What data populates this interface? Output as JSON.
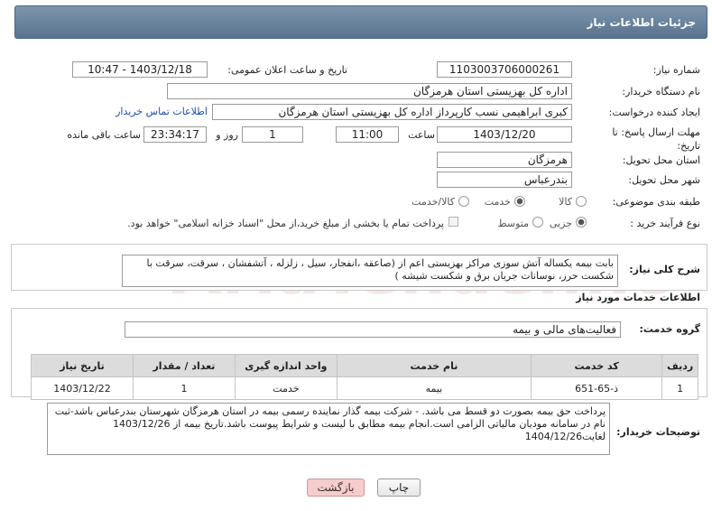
{
  "header": {
    "title": "جزئیات اطلاعات نیاز"
  },
  "need_number": {
    "label": "شماره نیاز:",
    "value": "1103003706000261"
  },
  "announce_datetime": {
    "label": "تاریخ و ساعت اعلان عمومی:",
    "value": "1403/12/18 - 10:47"
  },
  "buyer_org": {
    "label": "نام دستگاه خریدار:",
    "value": "اداره کل بهزیستی استان هرمزگان"
  },
  "requester": {
    "label": "ایجاد کننده درخواست:",
    "value": "کبری  ابراهیمی نسب کارپرداز اداره کل بهزیستی استان هرمزگان",
    "contact_link": "اطلاعات تماس خریدار"
  },
  "deadline": {
    "label": "مهلت ارسال پاسخ: تا تاریخ:",
    "date": "1403/12/20",
    "time_label": "ساعت",
    "time": "11:00",
    "days": "1",
    "days_label": "روز و",
    "remaining": "23:34:17",
    "remaining_label": "ساعت باقی مانده"
  },
  "delivery_province": {
    "label": "استان محل تحویل:",
    "value": "هرمزگان"
  },
  "delivery_city": {
    "label": "شهر محل تحویل:",
    "value": "بندرعباس"
  },
  "category": {
    "label": "طبقه بندی موضوعی:",
    "options": [
      "کالا",
      "خدمت",
      "کالا/خدمت"
    ],
    "selected": "خدمت"
  },
  "process_type": {
    "label": "نوع فرآیند خرید :",
    "options": [
      "جزیی",
      "متوسط"
    ],
    "selected": "جزیی",
    "payment_note": "پرداخت تمام یا بخشی از مبلغ خرید،از محل \"اسناد خزانه اسلامی\" خواهد بود."
  },
  "need_description": {
    "label": "شرح کلی نیاز:",
    "text": "بابت بیمه  یکساله آتش سوزی مراکز بهزیستی اعم از (صاعقه ،انفجار، سیل ، زلزله ، آتشفشان ، سرقت، سرقت با شکست  حرز، نوسانات جریان برق و شکست شیشه )"
  },
  "services_section": {
    "title": "اطلاعات خدمات مورد نیاز"
  },
  "service_group": {
    "label": "گروه خدمت:",
    "value": "فعالیت‌های مالی و بیمه"
  },
  "table": {
    "headers": [
      "ردیف",
      "کد خدمت",
      "نام خدمت",
      "واحد اندازه گیری",
      "تعداد / مقدار",
      "تاریخ نیاز"
    ],
    "rows": [
      [
        "1",
        "ذ-65-651",
        "بیمه",
        "خدمت",
        "1",
        "1403/12/22"
      ]
    ]
  },
  "buyer_notes": {
    "label": "توضیحات خریدار:",
    "text": "پرداخت حق بیمه بصورت دو قسط می باشد. - شرکت بیمه گذار نماینده رسمی بیمه در استان هرمزگان شهرستان بندرعباس باشد-ثبت نام در سامانه مودیان مالیاتی الزامی است.انجام بیمه مطابق با لیست و شرایط پیوست باشد.تاریخ بیمه از 1403/12/26 لغایت1404/12/26"
  },
  "buttons": {
    "print": "چاپ",
    "back": "بازگشت"
  },
  "watermark": {
    "text": "AriaTender.neT"
  },
  "colors": {
    "title_bar": "#6a829b",
    "link": "#1a4fb5",
    "back_button": "#f6cccc",
    "table_header": "#dcdcdc"
  }
}
